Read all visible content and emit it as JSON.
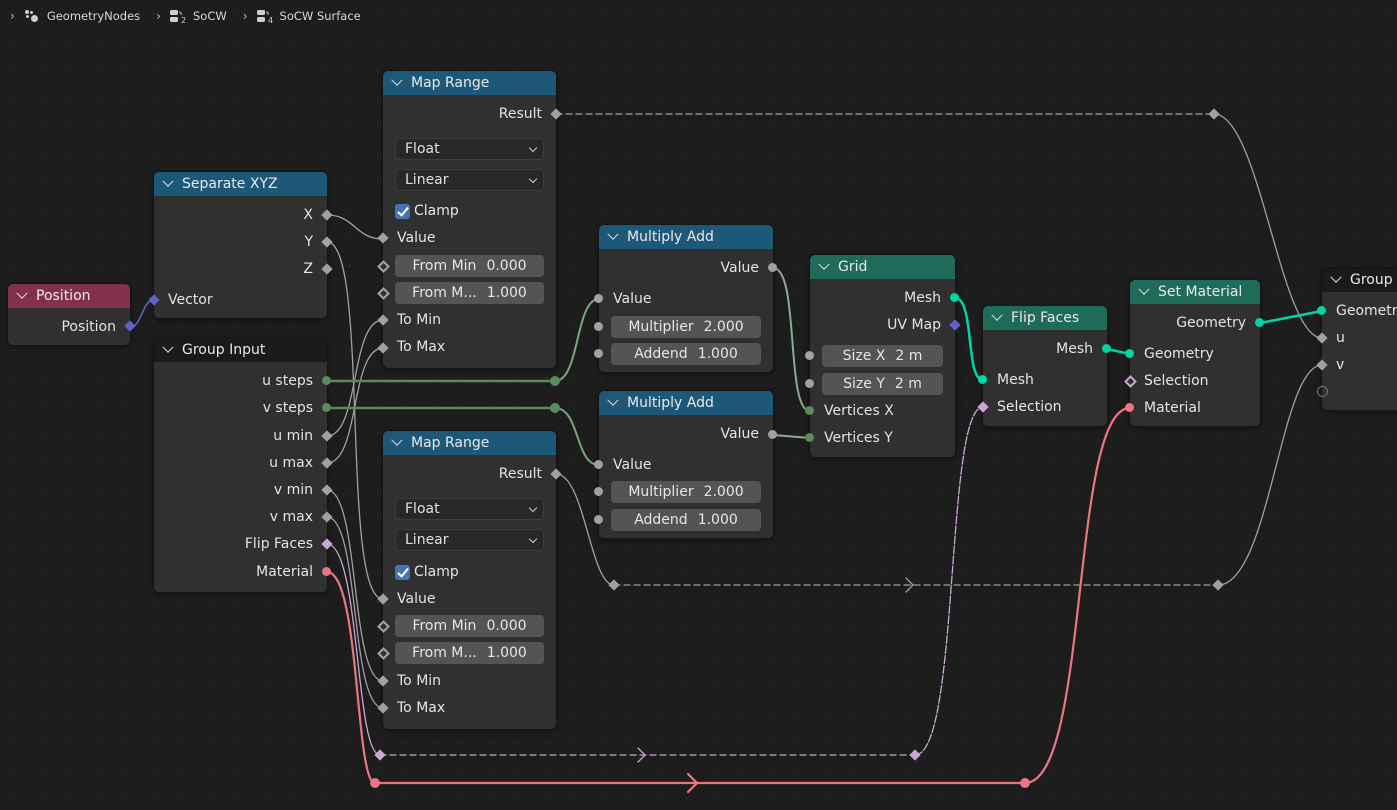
{
  "breadcrumb": [
    {
      "label": "GeometryNodes",
      "icon": "node-tree-icon"
    },
    {
      "label": "SoCW",
      "icon": "node-group-icon",
      "sub": "2"
    },
    {
      "label": "SoCW Surface",
      "icon": "node-group-icon",
      "sub": "4"
    }
  ],
  "colors": {
    "input_header": "#83314a",
    "converter_header": "#1e5878",
    "geometry_header": "#1e6b5a",
    "group_header": "#1a1a1a",
    "float_socket": "#a1a1a1",
    "int_socket": "#598c5c",
    "vector_socket": "#6363c7",
    "geometry_socket": "#00d6a3",
    "boolean_socket": "#cca6d6",
    "material_socket": "#eb7582"
  },
  "nodes": {
    "position": {
      "title": "Position",
      "outputs": [
        "Position"
      ]
    },
    "separate_xyz": {
      "title": "Separate XYZ",
      "outputs": [
        "X",
        "Y",
        "Z"
      ],
      "inputs": [
        "Vector"
      ]
    },
    "group_input": {
      "title": "Group Input",
      "outputs": [
        "u steps",
        "v steps",
        "u min",
        "u max",
        "v min",
        "v max",
        "Flip Faces",
        "Material"
      ]
    },
    "map_range_1": {
      "title": "Map Range",
      "output": "Result",
      "data_type": "Float",
      "interpolation": "Linear",
      "clamp_label": "Clamp",
      "clamp": true,
      "value_label": "Value",
      "from_min_label": "From Min",
      "from_min": "0.000",
      "from_max_label": "From M...",
      "from_max": "1.000",
      "to_min_label": "To Min",
      "to_max_label": "To Max"
    },
    "map_range_2": {
      "title": "Map Range",
      "output": "Result",
      "data_type": "Float",
      "interpolation": "Linear",
      "clamp_label": "Clamp",
      "clamp": true,
      "value_label": "Value",
      "from_min_label": "From Min",
      "from_min": "0.000",
      "from_max_label": "From M...",
      "from_max": "1.000",
      "to_min_label": "To Min",
      "to_max_label": "To Max"
    },
    "multiply_add_1": {
      "title": "Multiply Add",
      "output": "Value",
      "value_label": "Value",
      "multiplier_label": "Multiplier",
      "multiplier": "2.000",
      "addend_label": "Addend",
      "addend": "1.000"
    },
    "multiply_add_2": {
      "title": "Multiply Add",
      "output": "Value",
      "value_label": "Value",
      "multiplier_label": "Multiplier",
      "multiplier": "2.000",
      "addend_label": "Addend",
      "addend": "1.000"
    },
    "grid": {
      "title": "Grid",
      "outputs": [
        "Mesh",
        "UV Map"
      ],
      "size_x_label": "Size X",
      "size_x": "2 m",
      "size_y_label": "Size Y",
      "size_y": "2 m",
      "inputs": [
        "Vertices X",
        "Vertices Y"
      ]
    },
    "flip_faces": {
      "title": "Flip Faces",
      "output": "Mesh",
      "inputs": [
        "Mesh",
        "Selection"
      ]
    },
    "set_material": {
      "title": "Set Material",
      "output": "Geometry",
      "inputs": [
        "Geometry",
        "Selection",
        "Material"
      ]
    },
    "group_output": {
      "title": "Group",
      "inputs": [
        "Geometry",
        "u",
        "v"
      ]
    }
  }
}
